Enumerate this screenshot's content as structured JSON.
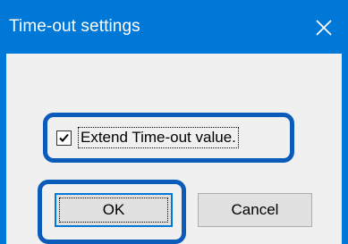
{
  "window": {
    "title": "Time-out settings",
    "close_icon": "close-icon"
  },
  "options": {
    "extend_timeout": {
      "label": "Extend Time-out value.",
      "checked": true
    }
  },
  "buttons": {
    "ok_label": "OK",
    "cancel_label": "Cancel"
  },
  "colors": {
    "titlebar": "#0078d7",
    "client": "#f0f0f0",
    "highlight": "#0b5cba",
    "button_face": "#e1e1e1"
  }
}
